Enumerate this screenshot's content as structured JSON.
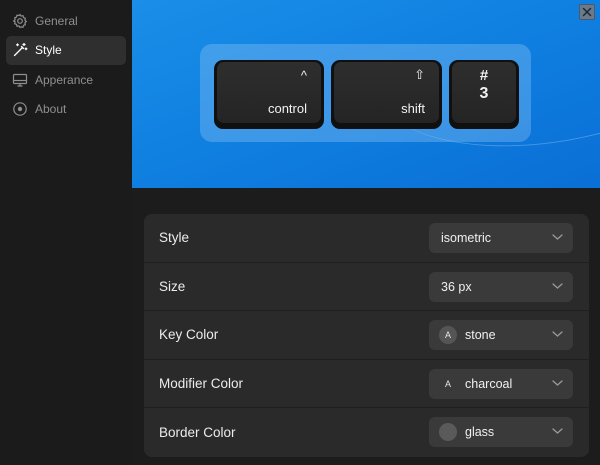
{
  "sidebar": {
    "items": [
      {
        "label": "General",
        "icon": "gear-icon",
        "active": false
      },
      {
        "label": "Style",
        "icon": "magic-wand-icon",
        "active": true
      },
      {
        "label": "Apperance",
        "icon": "monitor-icon",
        "active": false
      },
      {
        "label": "About",
        "icon": "info-circle-icon",
        "active": false
      }
    ]
  },
  "preview": {
    "keys": [
      {
        "label": "control",
        "symbol": "^"
      },
      {
        "label": "shift",
        "symbol": "⇧"
      },
      {
        "label": "3",
        "symbol": "#"
      }
    ]
  },
  "settings": {
    "rows": [
      {
        "label": "Style",
        "value": "isometric",
        "badge": ""
      },
      {
        "label": "Size",
        "value": "36 px",
        "badge": ""
      },
      {
        "label": "Key Color",
        "value": "stone",
        "badge": "A"
      },
      {
        "label": "Modifier Color",
        "value": "charcoal",
        "badge": "A"
      },
      {
        "label": "Border Color",
        "value": "glass",
        "badge": ""
      }
    ]
  },
  "colors": {
    "accent": "#0f7fe0",
    "sidebar_bg": "#1b1b1b",
    "panel_bg": "#2a2a2a"
  }
}
